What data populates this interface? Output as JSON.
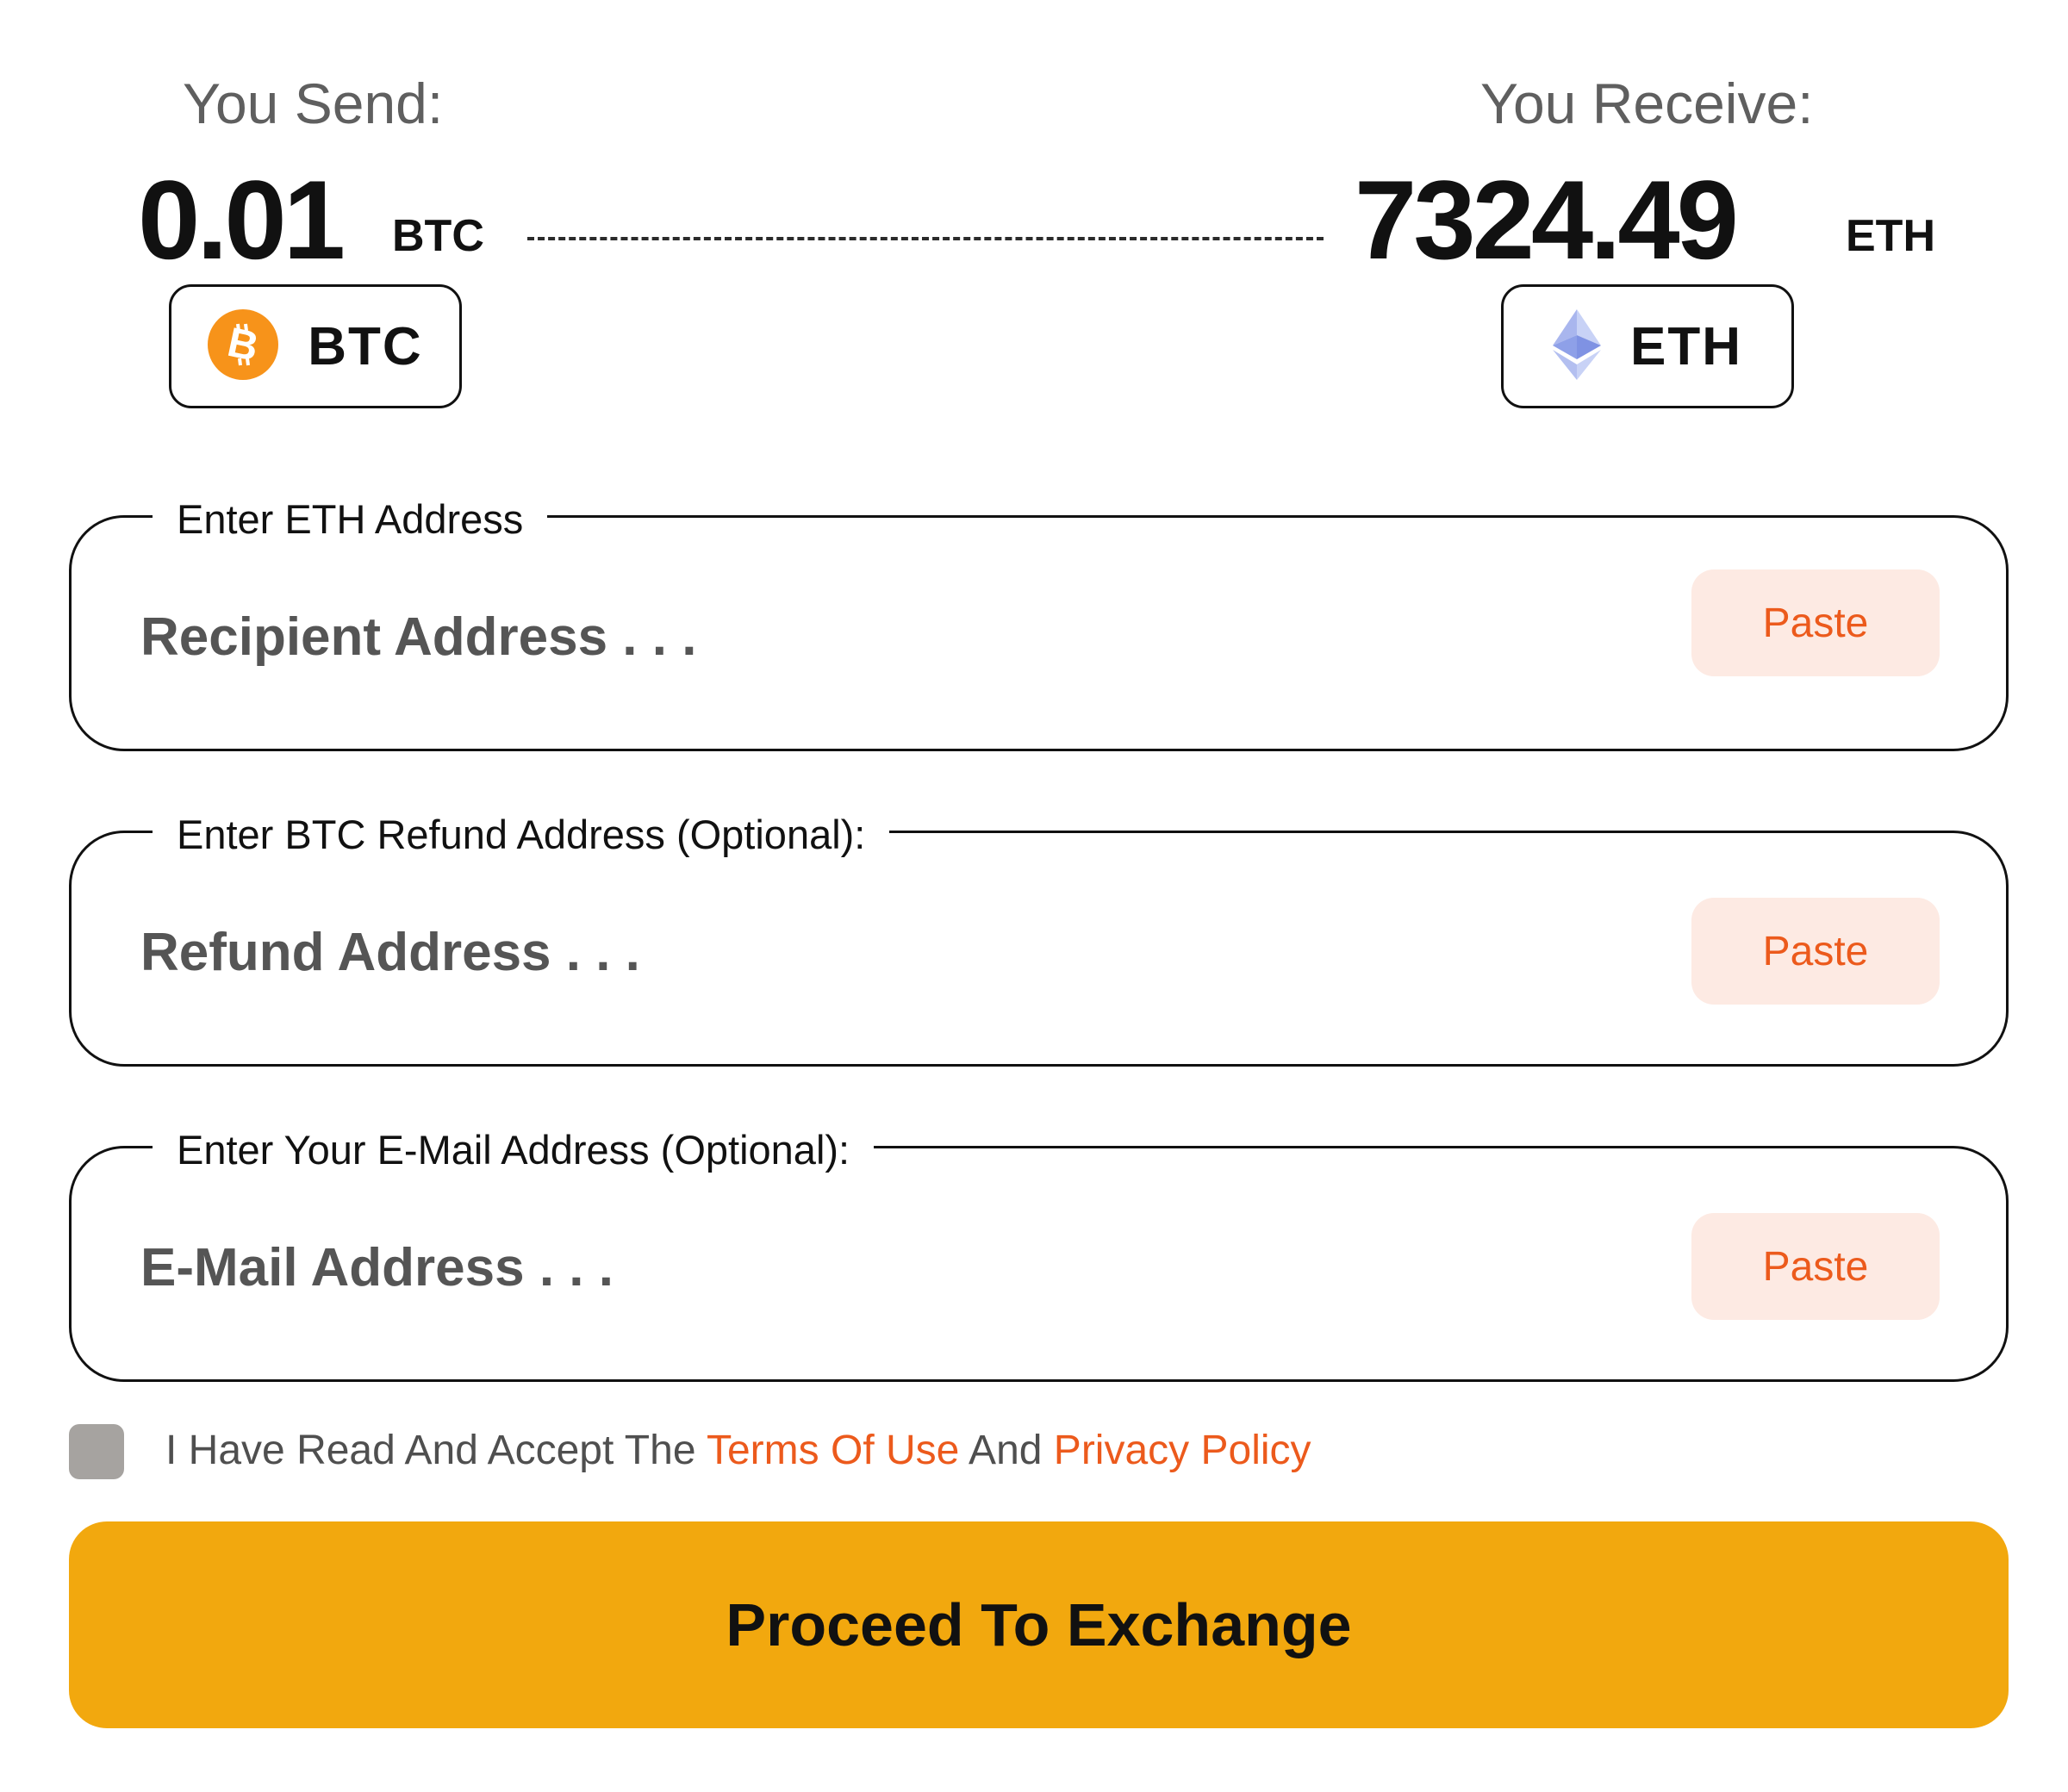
{
  "send": {
    "label": "You Send:",
    "amount": "0.01",
    "unit": "BTC",
    "coin": {
      "ticker": "BTC",
      "icon": "bitcoin-icon",
      "color": "#f7931a"
    }
  },
  "receive": {
    "label": "You Receive:",
    "amount": "7324.49",
    "unit": "ETH",
    "coin": {
      "ticker": "ETH",
      "icon": "ethereum-icon",
      "color": "#8a9de8"
    }
  },
  "fields": [
    {
      "legend": "Enter ETH Address",
      "placeholder": "Recipient Address . . .",
      "value": "",
      "paste_label": "Paste"
    },
    {
      "legend": "Enter BTC Refund Address (Optional):",
      "placeholder": "Refund Address . . .",
      "value": "",
      "paste_label": "Paste"
    },
    {
      "legend": "Enter Your E-Mail Address (Optional):",
      "placeholder": "E-Mail Address . . .",
      "value": "",
      "paste_label": "Paste"
    }
  ],
  "terms": {
    "checked": false,
    "prefix": "I Have Read And Accept The ",
    "terms_link": "Terms Of Use",
    "middle": " And ",
    "privacy_link": "Privacy Policy"
  },
  "proceed_label": "Proceed To Exchange",
  "colors": {
    "accent": "#ec5a1c",
    "paste_bg": "#fdeae3",
    "proceed_bg": "#f2a80e",
    "checkbox": "#a6a3a0"
  }
}
